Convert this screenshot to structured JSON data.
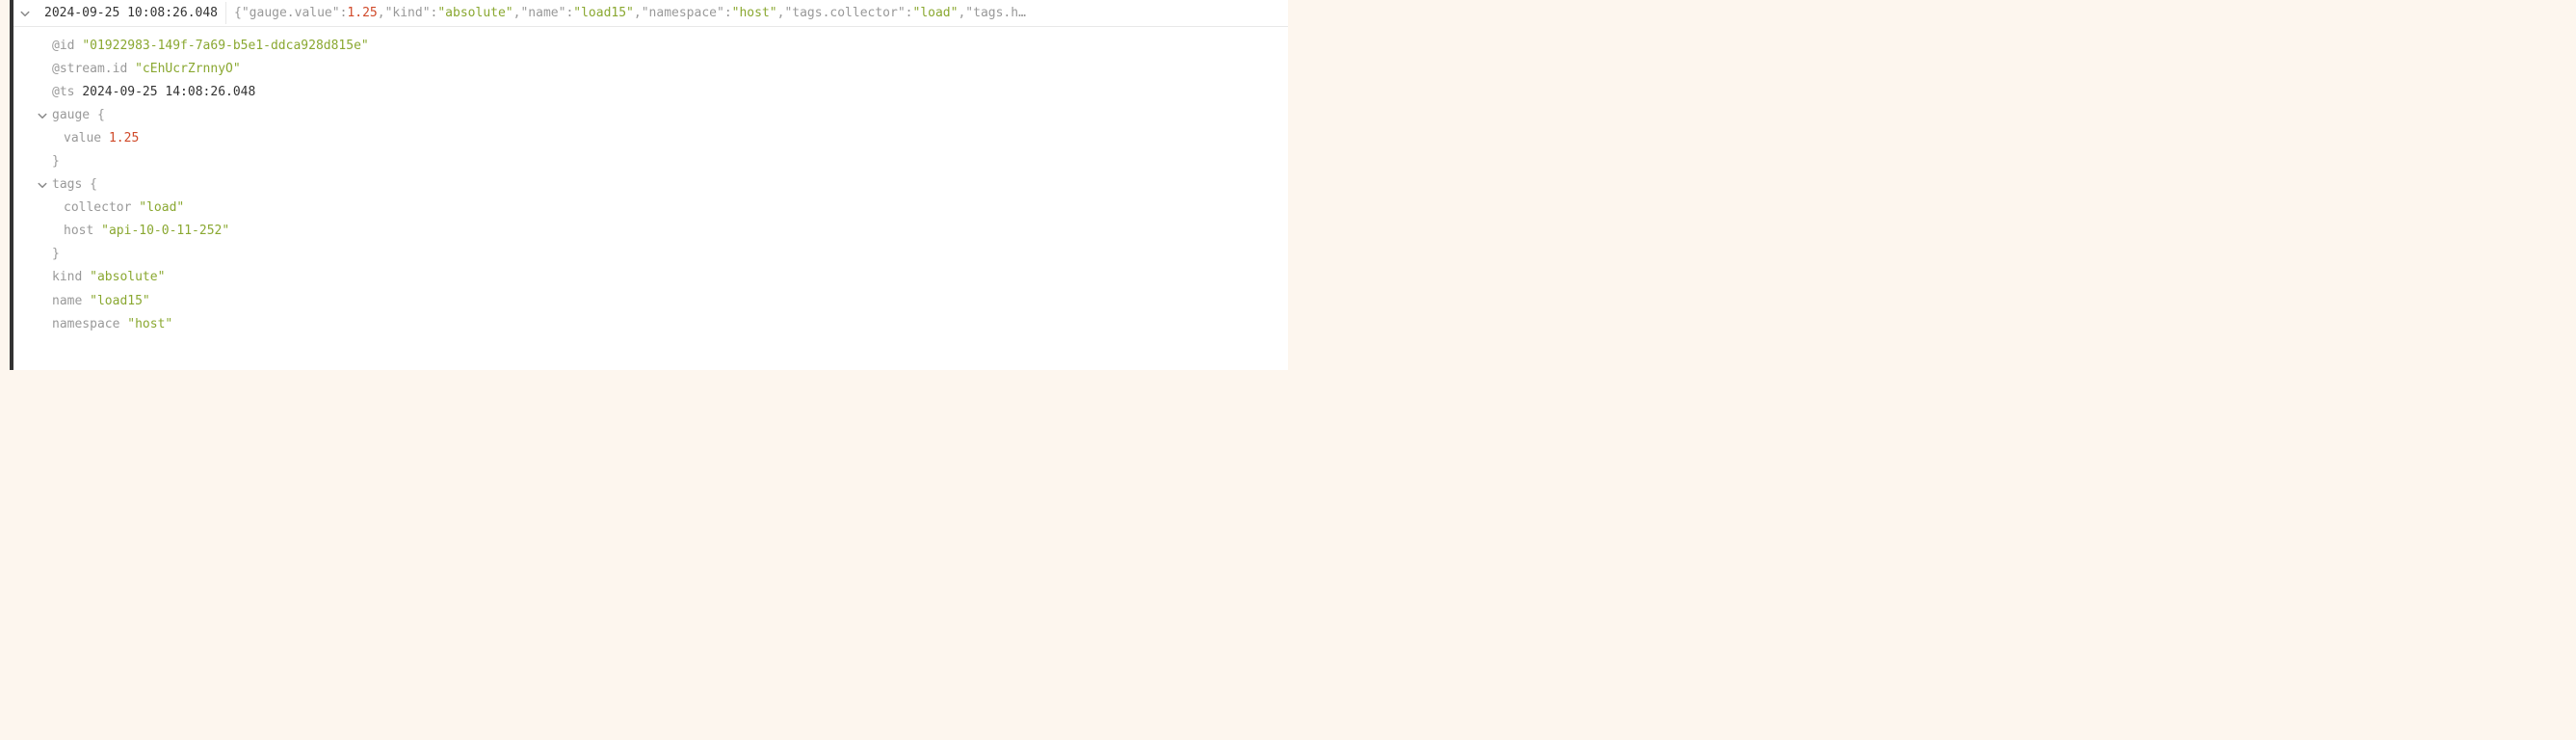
{
  "header": {
    "timestamp": "2024-09-25 10:08:26.048",
    "preview": {
      "k1": "\"gauge.value\"",
      "v1": "1.25",
      "k2": "\"kind\"",
      "v2": "\"absolute\"",
      "k3": "\"name\"",
      "v3": "\"load15\"",
      "k4": "\"namespace\"",
      "v4": "\"host\"",
      "k5": "\"tags.collector\"",
      "v5": "\"load\"",
      "k6": "\"tags.h…"
    }
  },
  "body": {
    "id_key": "@id",
    "id_val": "\"01922983-149f-7a69-b5e1-ddca928d815e\"",
    "stream_key": "@stream.id",
    "stream_val": "\"cEhUcrZrnnyO\"",
    "ts_key": "@ts",
    "ts_val": "2024-09-25 14:08:26.048",
    "gauge_key": "gauge",
    "gauge_open": "{",
    "gauge_value_key": "value",
    "gauge_value_val": "1.25",
    "gauge_close": "}",
    "tags_key": "tags",
    "tags_open": "{",
    "tags_collector_key": "collector",
    "tags_collector_val": "\"load\"",
    "tags_host_key": "host",
    "tags_host_val": "\"api-10-0-11-252\"",
    "tags_close": "}",
    "kind_key": "kind",
    "kind_val": "\"absolute\"",
    "name_key": "name",
    "name_val": "\"load15\"",
    "namespace_key": "namespace",
    "namespace_val": "\"host\""
  }
}
